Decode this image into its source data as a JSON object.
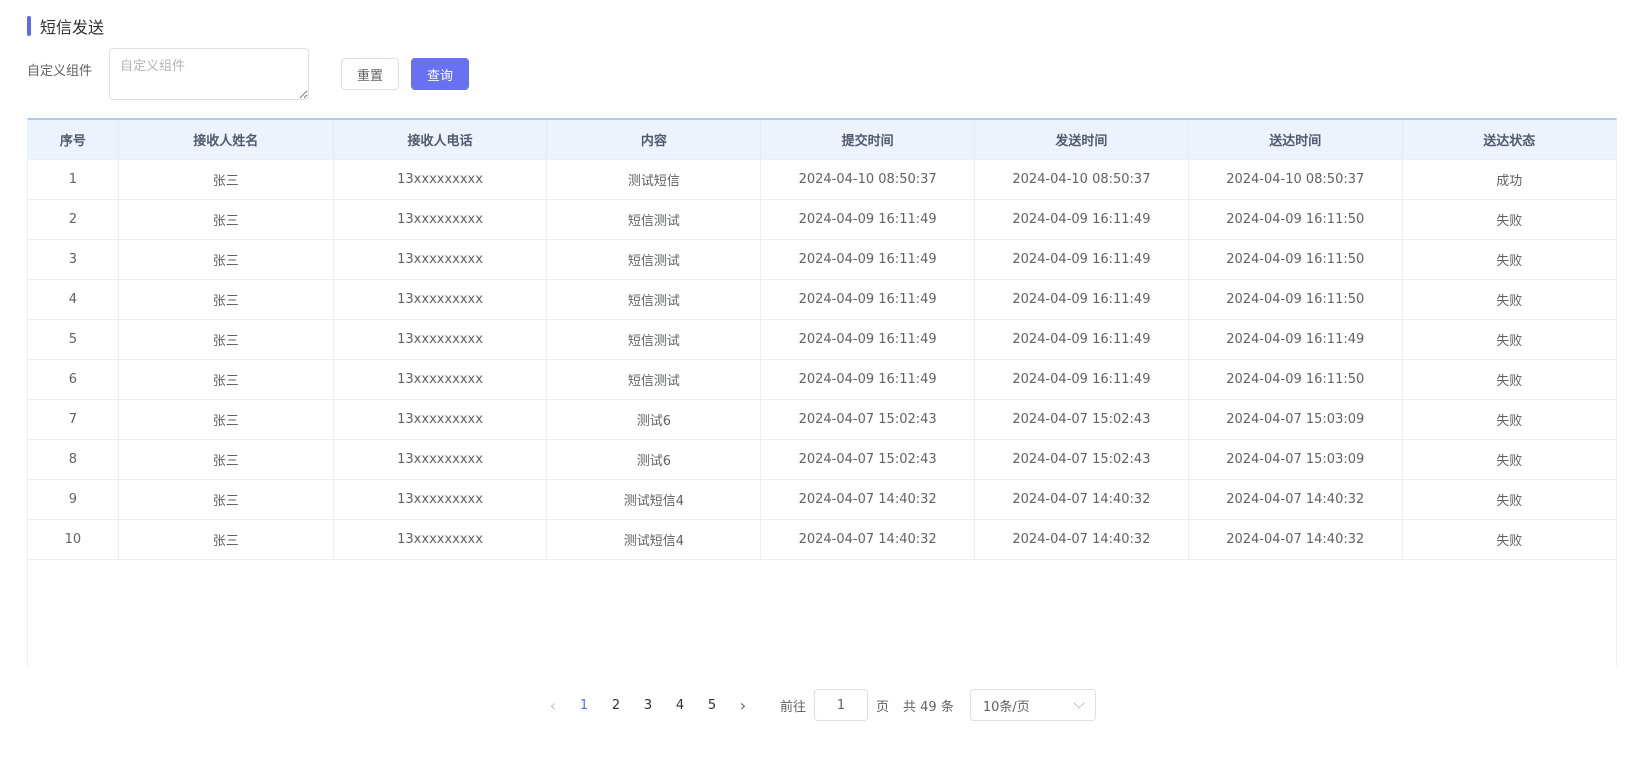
{
  "header": {
    "title": "短信发送"
  },
  "filter": {
    "label": "自定义组件",
    "textarea_placeholder": "自定义组件",
    "reset_label": "重置",
    "query_label": "查询"
  },
  "table": {
    "columns": [
      "序号",
      "接收人姓名",
      "接收人电话",
      "内容",
      "提交时间",
      "发送时间",
      "送达时间",
      "送达状态"
    ],
    "rows": [
      [
        "1",
        "张三",
        "13xxxxxxxxx",
        "测试短信",
        "2024-04-10 08:50:37",
        "2024-04-10 08:50:37",
        "2024-04-10 08:50:37",
        "成功"
      ],
      [
        "2",
        "张三",
        "13xxxxxxxxx",
        "短信测试",
        "2024-04-09 16:11:49",
        "2024-04-09 16:11:49",
        "2024-04-09 16:11:50",
        "失败"
      ],
      [
        "3",
        "张三",
        "13xxxxxxxxx",
        "短信测试",
        "2024-04-09 16:11:49",
        "2024-04-09 16:11:49",
        "2024-04-09 16:11:50",
        "失败"
      ],
      [
        "4",
        "张三",
        "13xxxxxxxxx",
        "短信测试",
        "2024-04-09 16:11:49",
        "2024-04-09 16:11:49",
        "2024-04-09 16:11:50",
        "失败"
      ],
      [
        "5",
        "张三",
        "13xxxxxxxxx",
        "短信测试",
        "2024-04-09 16:11:49",
        "2024-04-09 16:11:49",
        "2024-04-09 16:11:49",
        "失败"
      ],
      [
        "6",
        "张三",
        "13xxxxxxxxx",
        "短信测试",
        "2024-04-09 16:11:49",
        "2024-04-09 16:11:49",
        "2024-04-09 16:11:50",
        "失败"
      ],
      [
        "7",
        "张三",
        "13xxxxxxxxx",
        "测试6",
        "2024-04-07 15:02:43",
        "2024-04-07 15:02:43",
        "2024-04-07 15:03:09",
        "失败"
      ],
      [
        "8",
        "张三",
        "13xxxxxxxxx",
        "测试6",
        "2024-04-07 15:02:43",
        "2024-04-07 15:02:43",
        "2024-04-07 15:03:09",
        "失败"
      ],
      [
        "9",
        "张三",
        "13xxxxxxxxx",
        "测试短信4",
        "2024-04-07 14:40:32",
        "2024-04-07 14:40:32",
        "2024-04-07 14:40:32",
        "失败"
      ],
      [
        "10",
        "张三",
        "13xxxxxxxxx",
        "测试短信4",
        "2024-04-07 14:40:32",
        "2024-04-07 14:40:32",
        "2024-04-07 14:40:32",
        "失败"
      ]
    ]
  },
  "pagination": {
    "prev_icon": "chevron-left-icon",
    "next_icon": "chevron-right-icon",
    "pages": [
      "1",
      "2",
      "3",
      "4",
      "5"
    ],
    "current_page": "1",
    "goto_label": "前往",
    "goto_value": "1",
    "page_suffix": "页",
    "total_text": "共 49 条",
    "page_size": "10条/页"
  },
  "colors": {
    "accent": "#5b6cf0",
    "primary_button": "#6771f2",
    "header_bg": "#edf3fc"
  }
}
